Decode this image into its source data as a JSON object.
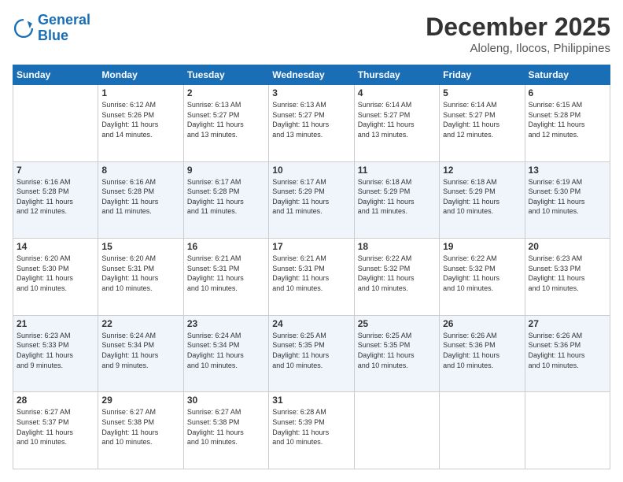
{
  "logo": {
    "line1": "General",
    "line2": "Blue"
  },
  "header": {
    "month": "December 2025",
    "location": "Aloleng, Ilocos, Philippines"
  },
  "weekdays": [
    "Sunday",
    "Monday",
    "Tuesday",
    "Wednesday",
    "Thursday",
    "Friday",
    "Saturday"
  ],
  "weeks": [
    [
      {
        "day": "",
        "info": ""
      },
      {
        "day": "1",
        "info": "Sunrise: 6:12 AM\nSunset: 5:26 PM\nDaylight: 11 hours\nand 14 minutes."
      },
      {
        "day": "2",
        "info": "Sunrise: 6:13 AM\nSunset: 5:27 PM\nDaylight: 11 hours\nand 13 minutes."
      },
      {
        "day": "3",
        "info": "Sunrise: 6:13 AM\nSunset: 5:27 PM\nDaylight: 11 hours\nand 13 minutes."
      },
      {
        "day": "4",
        "info": "Sunrise: 6:14 AM\nSunset: 5:27 PM\nDaylight: 11 hours\nand 13 minutes."
      },
      {
        "day": "5",
        "info": "Sunrise: 6:14 AM\nSunset: 5:27 PM\nDaylight: 11 hours\nand 12 minutes."
      },
      {
        "day": "6",
        "info": "Sunrise: 6:15 AM\nSunset: 5:28 PM\nDaylight: 11 hours\nand 12 minutes."
      }
    ],
    [
      {
        "day": "7",
        "info": "Sunrise: 6:16 AM\nSunset: 5:28 PM\nDaylight: 11 hours\nand 12 minutes."
      },
      {
        "day": "8",
        "info": "Sunrise: 6:16 AM\nSunset: 5:28 PM\nDaylight: 11 hours\nand 11 minutes."
      },
      {
        "day": "9",
        "info": "Sunrise: 6:17 AM\nSunset: 5:28 PM\nDaylight: 11 hours\nand 11 minutes."
      },
      {
        "day": "10",
        "info": "Sunrise: 6:17 AM\nSunset: 5:29 PM\nDaylight: 11 hours\nand 11 minutes."
      },
      {
        "day": "11",
        "info": "Sunrise: 6:18 AM\nSunset: 5:29 PM\nDaylight: 11 hours\nand 11 minutes."
      },
      {
        "day": "12",
        "info": "Sunrise: 6:18 AM\nSunset: 5:29 PM\nDaylight: 11 hours\nand 10 minutes."
      },
      {
        "day": "13",
        "info": "Sunrise: 6:19 AM\nSunset: 5:30 PM\nDaylight: 11 hours\nand 10 minutes."
      }
    ],
    [
      {
        "day": "14",
        "info": "Sunrise: 6:20 AM\nSunset: 5:30 PM\nDaylight: 11 hours\nand 10 minutes."
      },
      {
        "day": "15",
        "info": "Sunrise: 6:20 AM\nSunset: 5:31 PM\nDaylight: 11 hours\nand 10 minutes."
      },
      {
        "day": "16",
        "info": "Sunrise: 6:21 AM\nSunset: 5:31 PM\nDaylight: 11 hours\nand 10 minutes."
      },
      {
        "day": "17",
        "info": "Sunrise: 6:21 AM\nSunset: 5:31 PM\nDaylight: 11 hours\nand 10 minutes."
      },
      {
        "day": "18",
        "info": "Sunrise: 6:22 AM\nSunset: 5:32 PM\nDaylight: 11 hours\nand 10 minutes."
      },
      {
        "day": "19",
        "info": "Sunrise: 6:22 AM\nSunset: 5:32 PM\nDaylight: 11 hours\nand 10 minutes."
      },
      {
        "day": "20",
        "info": "Sunrise: 6:23 AM\nSunset: 5:33 PM\nDaylight: 11 hours\nand 10 minutes."
      }
    ],
    [
      {
        "day": "21",
        "info": "Sunrise: 6:23 AM\nSunset: 5:33 PM\nDaylight: 11 hours\nand 9 minutes."
      },
      {
        "day": "22",
        "info": "Sunrise: 6:24 AM\nSunset: 5:34 PM\nDaylight: 11 hours\nand 9 minutes."
      },
      {
        "day": "23",
        "info": "Sunrise: 6:24 AM\nSunset: 5:34 PM\nDaylight: 11 hours\nand 10 minutes."
      },
      {
        "day": "24",
        "info": "Sunrise: 6:25 AM\nSunset: 5:35 PM\nDaylight: 11 hours\nand 10 minutes."
      },
      {
        "day": "25",
        "info": "Sunrise: 6:25 AM\nSunset: 5:35 PM\nDaylight: 11 hours\nand 10 minutes."
      },
      {
        "day": "26",
        "info": "Sunrise: 6:26 AM\nSunset: 5:36 PM\nDaylight: 11 hours\nand 10 minutes."
      },
      {
        "day": "27",
        "info": "Sunrise: 6:26 AM\nSunset: 5:36 PM\nDaylight: 11 hours\nand 10 minutes."
      }
    ],
    [
      {
        "day": "28",
        "info": "Sunrise: 6:27 AM\nSunset: 5:37 PM\nDaylight: 11 hours\nand 10 minutes."
      },
      {
        "day": "29",
        "info": "Sunrise: 6:27 AM\nSunset: 5:38 PM\nDaylight: 11 hours\nand 10 minutes."
      },
      {
        "day": "30",
        "info": "Sunrise: 6:27 AM\nSunset: 5:38 PM\nDaylight: 11 hours\nand 10 minutes."
      },
      {
        "day": "31",
        "info": "Sunrise: 6:28 AM\nSunset: 5:39 PM\nDaylight: 11 hours\nand 10 minutes."
      },
      {
        "day": "",
        "info": ""
      },
      {
        "day": "",
        "info": ""
      },
      {
        "day": "",
        "info": ""
      }
    ]
  ]
}
